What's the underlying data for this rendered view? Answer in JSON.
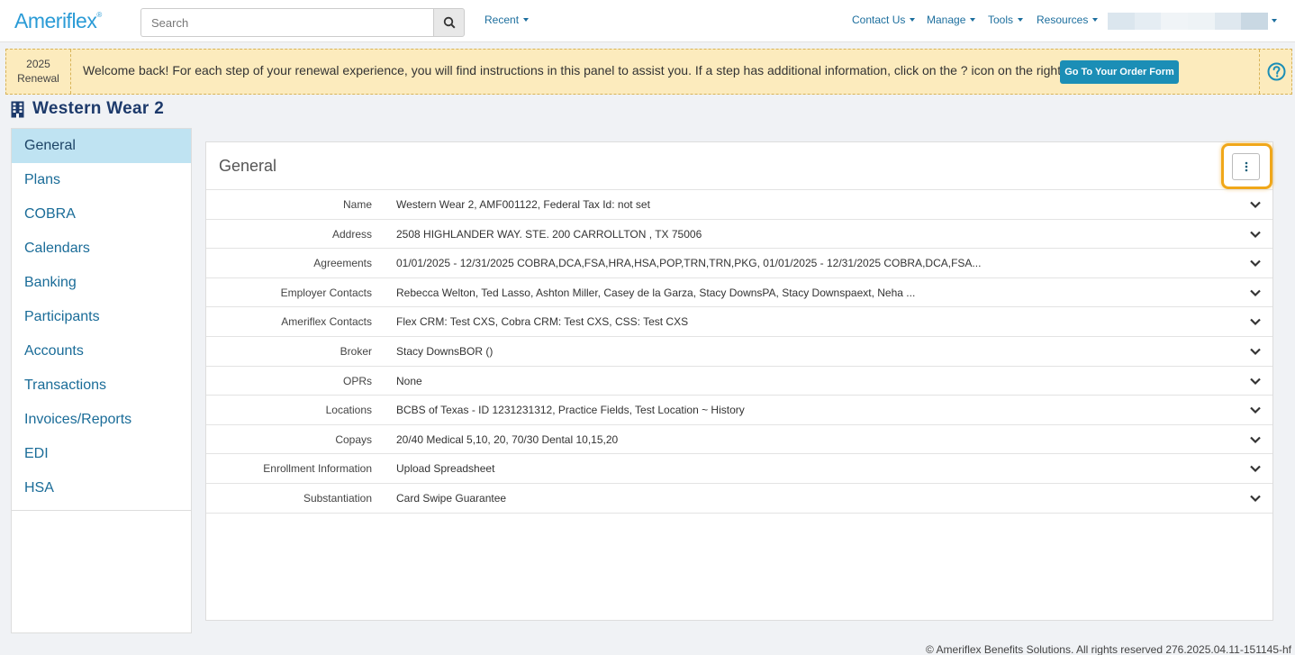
{
  "header": {
    "logo_text": "Ameriflex",
    "logo_mark": "®",
    "search_placeholder": "Search",
    "nav": {
      "recent": "Recent",
      "contact_us": "Contact Us",
      "manage": "Manage",
      "tools": "Tools",
      "resources": "Resources"
    },
    "user_blur_colors": [
      "#dbe6ee",
      "#e5edf3",
      "#f0f4f7",
      "#eef3f6",
      "#dfe8ef",
      "#c9d8e3"
    ]
  },
  "banner": {
    "year": "2025",
    "renewal": "Renewal",
    "text": "Welcome back! For each step of your renewal experience, you will find instructions in this panel to assist you. If a step has additional information, click on the ? icon on the right.",
    "order_button": "Go To Your Order Form"
  },
  "page": {
    "title": "Western Wear 2"
  },
  "sidebar": {
    "items": [
      {
        "label": "General",
        "active": true
      },
      {
        "label": "Plans"
      },
      {
        "label": "COBRA"
      },
      {
        "label": "Calendars"
      },
      {
        "label": "Banking"
      },
      {
        "label": "Participants"
      },
      {
        "label": "Accounts"
      },
      {
        "label": "Transactions"
      },
      {
        "label": "Invoices/Reports"
      },
      {
        "label": "EDI"
      },
      {
        "label": "HSA"
      }
    ]
  },
  "panel": {
    "title": "General",
    "rows": [
      {
        "label": "Name",
        "value": "Western Wear 2, AMF001122, Federal Tax Id: not set"
      },
      {
        "label": "Address",
        "value": "2508 HIGHLANDER WAY. STE. 200 CARROLLTON , TX 75006"
      },
      {
        "label": "Agreements",
        "value": "01/01/2025 - 12/31/2025 COBRA,DCA,FSA,HRA,HSA,POP,TRN,TRN,PKG, 01/01/2025 - 12/31/2025 COBRA,DCA,FSA..."
      },
      {
        "label": "Employer Contacts",
        "value": "Rebecca Welton, Ted Lasso, Ashton Miller, Casey de la Garza, Stacy DownsPA, Stacy Downspaext, Neha ..."
      },
      {
        "label": "Ameriflex Contacts",
        "value": "Flex CRM: Test CXS, Cobra CRM: Test CXS, CSS: Test CXS"
      },
      {
        "label": "Broker",
        "value": "Stacy DownsBOR ()"
      },
      {
        "label": "OPRs",
        "value": "None"
      },
      {
        "label": "Locations",
        "value": "BCBS of Texas - ID 1231231312, Practice Fields, Test Location ~ History"
      },
      {
        "label": "Copays",
        "value": "20/40 Medical 5,10, 20, 70/30 Dental 10,15,20"
      },
      {
        "label": "Enrollment Information",
        "value": "Upload Spreadsheet"
      },
      {
        "label": "Substantiation",
        "value": "Card Swipe Guarantee"
      }
    ]
  },
  "footer": {
    "text": "© Ameriflex Benefits Solutions. All rights reserved 276.2025.04.11-151145-hf"
  },
  "colors": {
    "accent": "#1b8eb6",
    "highlight": "#f0a719",
    "banner": "#fcebbd",
    "active_nav": "#bfe3f2"
  }
}
